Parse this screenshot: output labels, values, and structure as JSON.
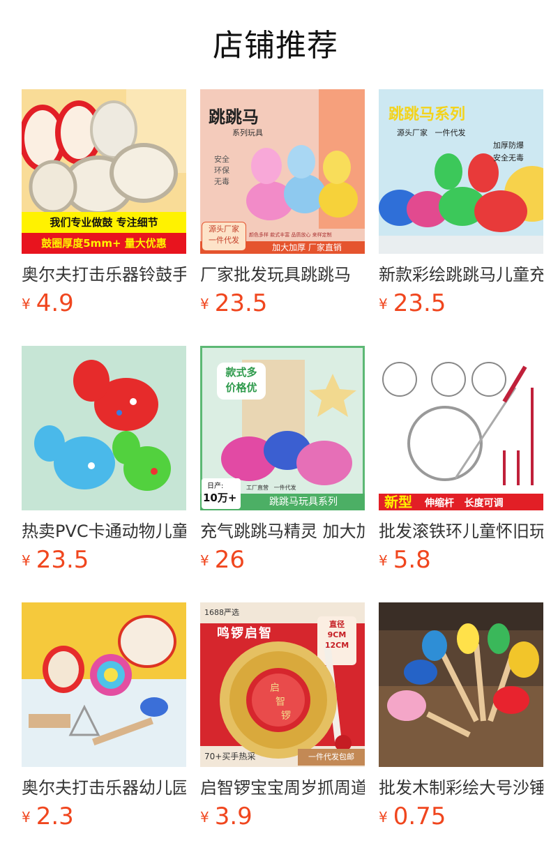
{
  "page": {
    "title": "店铺推荐"
  },
  "products": [
    {
      "name": "奥尔夫打击乐器铃鼓手拍鼓",
      "currency": "¥",
      "price": "4.9",
      "image": {
        "banner_top": "我们专业做鼓 专注细节",
        "banner_bottom": "鼓圈厚度5mm+ 量大优惠",
        "bg": "#f8d88e"
      }
    },
    {
      "name": "厂家批发玩具跳跳马",
      "currency": "¥",
      "price": "23.5",
      "image": {
        "heading": "跳跳马",
        "subheading": "系列玩具",
        "side_text": [
          "安全",
          "环保",
          "无毒"
        ],
        "badge": [
          "源头厂家",
          "一件代发"
        ],
        "features": "颜色多样 款式丰富 品质放心 来样定制",
        "banner": "加大加厚  厂家直销",
        "bg": "#f3c9ba"
      }
    },
    {
      "name": "新款彩绘跳跳马儿童充气",
      "currency": "¥",
      "price": "23.5",
      "image": {
        "heading": "跳跳马系列",
        "subheading": "源头厂家   一件代发",
        "side_text": [
          "加厚防爆",
          "安全无毒"
        ],
        "bg": "#cfe9f3"
      }
    },
    {
      "name": "热卖PVC卡通动物儿童跳跳鹿",
      "currency": "¥",
      "price": "23.5",
      "image": {
        "bg": "#c7e6d6"
      }
    },
    {
      "name": "充气跳跳马精灵 加大加厚",
      "currency": "¥",
      "price": "26",
      "image": {
        "bubble": [
          "款式多",
          "价格优"
        ],
        "daily_label": "日产:",
        "daily_value": "10万+",
        "factory": "工厂直营   一件代发",
        "banner": "跳跳马玩具系列",
        "bg": "#d9efe1"
      }
    },
    {
      "name": "批发滚铁环儿童怀旧玩具",
      "currency": "¥",
      "price": "5.8",
      "image": {
        "banner_new": "新型",
        "banner_text": "伸缩杆   长度可调",
        "bg": "#ffffff"
      }
    },
    {
      "name": "奥尔夫打击乐器幼儿园套装",
      "currency": "¥",
      "price": "2.3",
      "image": {
        "bg": "#e8f1f6"
      }
    },
    {
      "name": "启智锣宝宝周岁抓周道具",
      "currency": "¥",
      "price": "3.9",
      "image": {
        "tag": "1688严选",
        "heading": "鸣锣启智",
        "size_label": [
          "直径",
          "9CM",
          "12CM"
        ],
        "gong_text": [
          "启",
          "智",
          "锣"
        ],
        "bottom_left": "70+买手热采",
        "bottom_right": "一件代发包邮",
        "bg": "#d6262d"
      }
    },
    {
      "name": "批发木制彩绘大号沙锤",
      "currency": "¥",
      "price": "0.75",
      "image": {
        "bg": "#5a4433"
      }
    }
  ]
}
